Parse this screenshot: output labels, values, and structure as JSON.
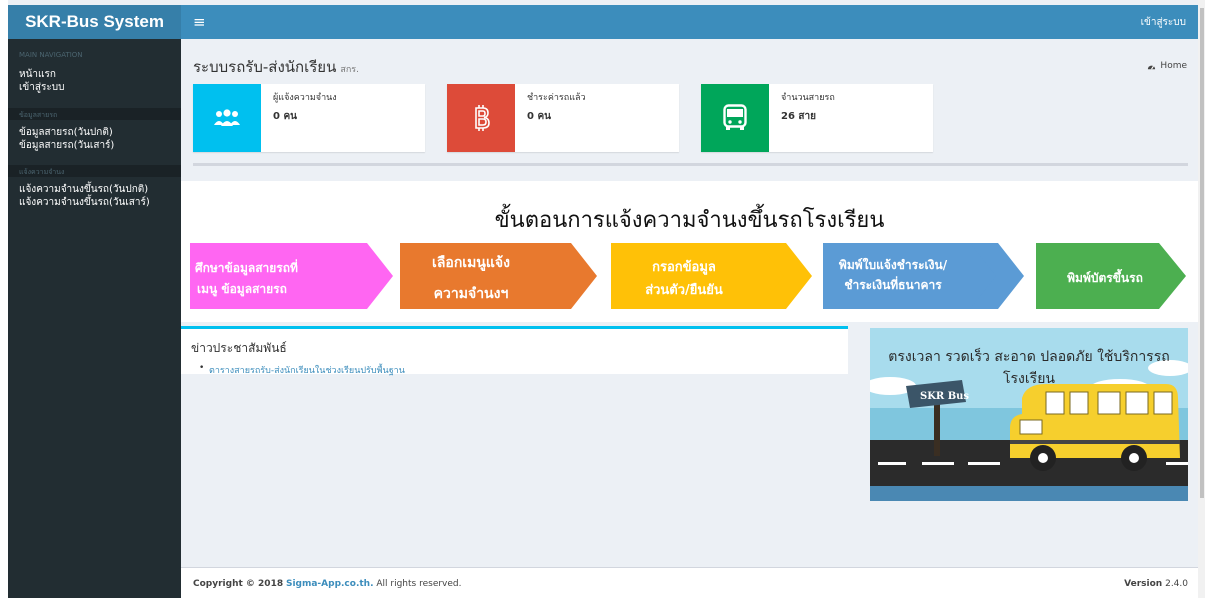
{
  "header": {
    "logo": "SKR-Bus System",
    "menu_icon": "hamburger-icon",
    "login_link": "เข้าสู่ระบบ"
  },
  "sidebar": {
    "main_header": "MAIN NAVIGATION",
    "main_items": [
      {
        "label": "หน้าแรก"
      },
      {
        "label": "เข้าสู่ระบบ"
      }
    ],
    "routes_header": "ข้อมูลสายรถ",
    "routes_items": [
      {
        "label": "ข้อมูลสายรถ(วันปกติ)"
      },
      {
        "label": "ข้อมูลสายรถ(วันเสาร์)"
      }
    ],
    "notify_header": "แจ้งความจำนง",
    "notify_items": [
      {
        "label": "แจ้งความจำนงขึ้นรถ(วันปกติ)"
      },
      {
        "label": "แจ้งความจำนงขึ้นรถ(วันเสาร์)"
      }
    ]
  },
  "content_header": {
    "title": "ระบบรถรับ-ส่งนักเรียน",
    "subtitle": "สกร.",
    "breadcrumb": "Home",
    "breadcrumb_icon": "dashboard-icon"
  },
  "info_boxes": [
    {
      "label": "ผู้แจ้งความจำนง",
      "value": "0 คน",
      "color": "#00c0ef",
      "icon": "users-icon"
    },
    {
      "label": "ชำระค่ารถแล้ว",
      "value": "0 คน",
      "color": "#dd4b39",
      "icon": "bitcoin-icon"
    },
    {
      "label": "จำนวนสายรถ",
      "value": "26 สาย",
      "color": "#00a65a",
      "icon": "bus-icon"
    }
  ],
  "steps": {
    "title": "ขั้นตอนการแจ้งความจำนงขึ้นรถโรงเรียน",
    "items": [
      {
        "line1": "ศึกษาข้อมูลสายรถที่",
        "line2": "เมนู ข้อมูลสายรถ",
        "color": "#ff66f2"
      },
      {
        "line1": "เลือกเมนูแจ้ง",
        "line2": "ความจำนงฯ",
        "color": "#e8792e"
      },
      {
        "line1": "กรอกข้อมูล",
        "line2": "ส่วนตัว/ยืนยัน",
        "color": "#ffc107"
      },
      {
        "line1": "พิมพ์ใบแจ้งชำระเงิน/",
        "line2": "ชำระเงินที่ธนาคาร",
        "color": "#5b9bd5"
      },
      {
        "line1": "พิมพ์บัตรขึ้นรถ",
        "line2": "",
        "color": "#4caf50"
      }
    ]
  },
  "news": {
    "title": "ข่าวประชาสัมพันธ์",
    "items": [
      {
        "label": "ตารางสายรถรับ-ส่งนักเรียนในช่วงเรียนปรับพื้นฐาน"
      }
    ]
  },
  "banner": {
    "tagline": "ตรงเวลา รวดเร็ว สะอาด ปลอดภัย ใช้บริการรถโรงเรียน",
    "sign_text": "SKR Bus"
  },
  "footer": {
    "copyright_prefix": "Copyright © 2018",
    "company": "Sigma-App.co.th.",
    "rights": "All rights reserved.",
    "version_label": "Version",
    "version_number": "2.4.0"
  }
}
